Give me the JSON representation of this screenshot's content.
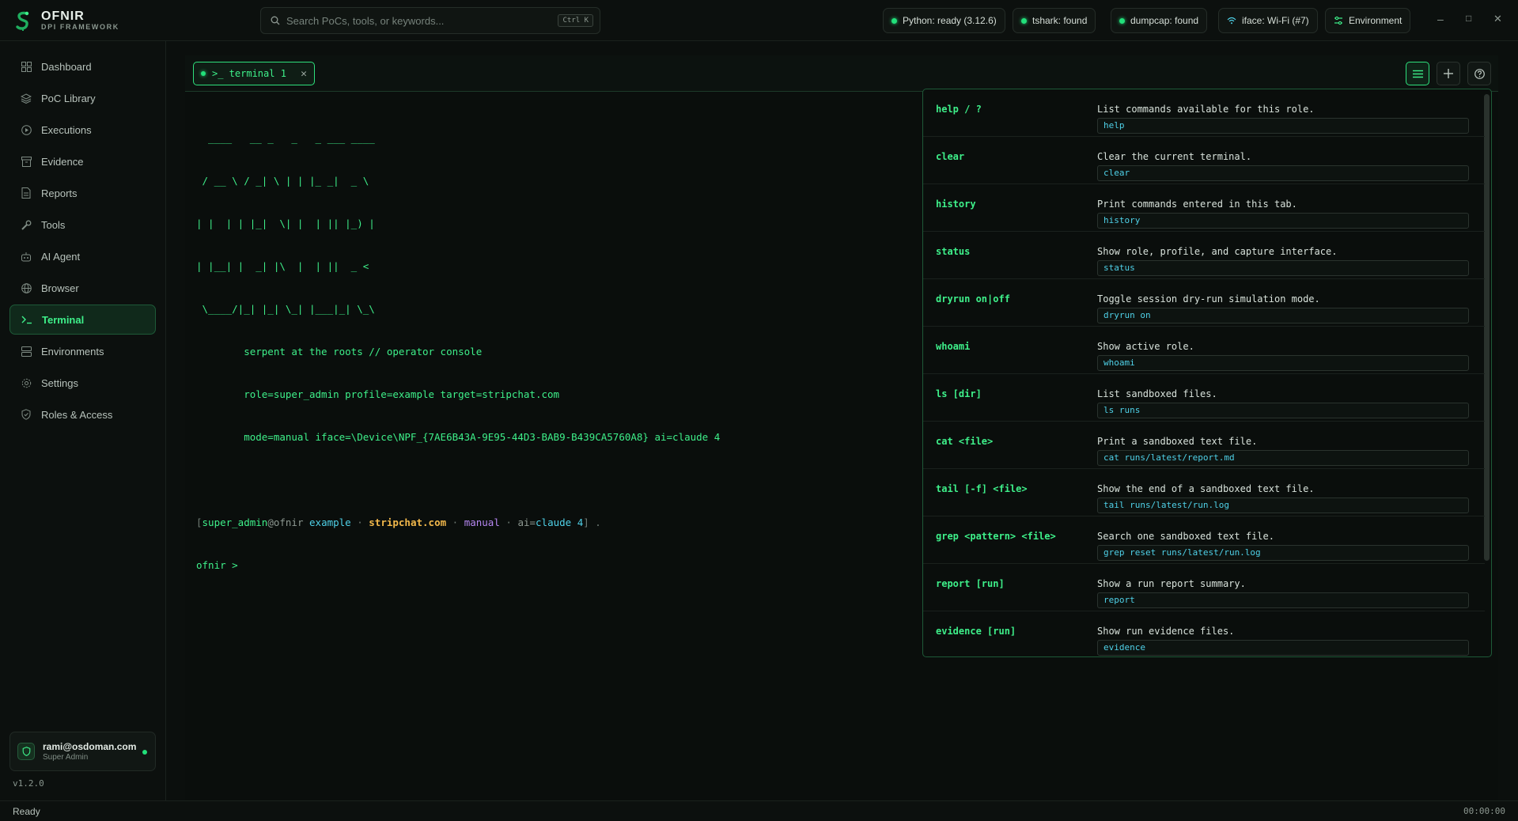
{
  "app": {
    "name": "OFNIR",
    "subtitle": "DPI FRAMEWORK"
  },
  "search": {
    "placeholder": "Search PoCs, tools, or keywords...",
    "shortcut": "Ctrl K"
  },
  "header_status": {
    "python": "Python: ready (3.12.6)",
    "tshark": "tshark: found",
    "dumpcap": "dumpcap: found",
    "iface": "iface: Wi-Fi (#7)",
    "environment": "Environment"
  },
  "window_controls": {
    "minimize": "–",
    "maximize": "□",
    "close": "✕"
  },
  "sidebar": {
    "items": [
      {
        "label": "Dashboard",
        "icon": "grid-icon"
      },
      {
        "label": "PoC Library",
        "icon": "layers-icon"
      },
      {
        "label": "Executions",
        "icon": "play-circle-icon"
      },
      {
        "label": "Evidence",
        "icon": "archive-icon"
      },
      {
        "label": "Reports",
        "icon": "file-icon"
      },
      {
        "label": "Tools",
        "icon": "wrench-icon"
      },
      {
        "label": "AI Agent",
        "icon": "bot-icon"
      },
      {
        "label": "Browser",
        "icon": "globe-icon"
      },
      {
        "label": "Terminal",
        "icon": "terminal-icon",
        "active": true
      },
      {
        "label": "Environments",
        "icon": "server-icon"
      },
      {
        "label": "Settings",
        "icon": "gear-icon"
      },
      {
        "label": "Roles & Access",
        "icon": "shield-icon"
      }
    ],
    "user": {
      "email": "rami@osdoman.com",
      "role": "Super Admin"
    },
    "version": "v1.2.0"
  },
  "terminal": {
    "tab_label": ">_ terminal 1",
    "banner": [
      "  ____   __ _   _   _ ___ ____",
      " / __ \\ / _| \\ | | |_ _|  _ \\",
      "| |  | | |_|  \\| |  | || |_) |",
      "| |__| |  _| |\\  |  | ||  _ <",
      " \\____/|_| |_| \\_| |___|_| \\_\\",
      "        serpent at the roots // operator console",
      "        role=super_admin profile=example target=stripchat.com",
      "        mode=manual iface=\\Device\\NPF_{7AE6B43A-9E95-44D3-BAB9-B439CA5760A8} ai=claude 4"
    ],
    "prompt": {
      "open": "[",
      "user": "super_admin",
      "host": "@ofnir",
      "profile": "example",
      "sep1": " · ",
      "target": "stripchat.com",
      "sep2": " · ",
      "mode": "manual",
      "sep3": " · ",
      "ai_key": "ai=",
      "ai_val": "claude 4",
      "close": "] .",
      "input_prefix": "ofnir >"
    }
  },
  "help": {
    "commands": [
      {
        "name": "help / ?",
        "desc": "List commands available for this role.",
        "example": "help"
      },
      {
        "name": "clear",
        "desc": "Clear the current terminal.",
        "example": "clear"
      },
      {
        "name": "history",
        "desc": "Print commands entered in this tab.",
        "example": "history"
      },
      {
        "name": "status",
        "desc": "Show role, profile, and capture interface.",
        "example": "status"
      },
      {
        "name": "dryrun on|off",
        "desc": "Toggle session dry-run simulation mode.",
        "example": "dryrun on"
      },
      {
        "name": "whoami",
        "desc": "Show active role.",
        "example": "whoami"
      },
      {
        "name": "ls [dir]",
        "desc": "List sandboxed files.",
        "example": "ls runs"
      },
      {
        "name": "cat <file>",
        "desc": "Print a sandboxed text file.",
        "example": "cat runs/latest/report.md"
      },
      {
        "name": "tail [-f] <file>",
        "desc": "Show the end of a sandboxed text file.",
        "example": "tail runs/latest/run.log"
      },
      {
        "name": "grep <pattern> <file>",
        "desc": "Search one sandboxed text file.",
        "example": "grep reset runs/latest/run.log"
      },
      {
        "name": "report [run]",
        "desc": "Show a run report summary.",
        "example": "report"
      },
      {
        "name": "evidence [run]",
        "desc": "Show run evidence files.",
        "example": "evidence"
      }
    ]
  },
  "statusbar": {
    "left": "Ready",
    "right": "00:00:00"
  },
  "colors": {
    "accent": "#3ef08a",
    "bg": "#0b0f0d",
    "cyan": "#4fd1e8",
    "amber": "#f2b84b",
    "purple": "#b687f2"
  }
}
